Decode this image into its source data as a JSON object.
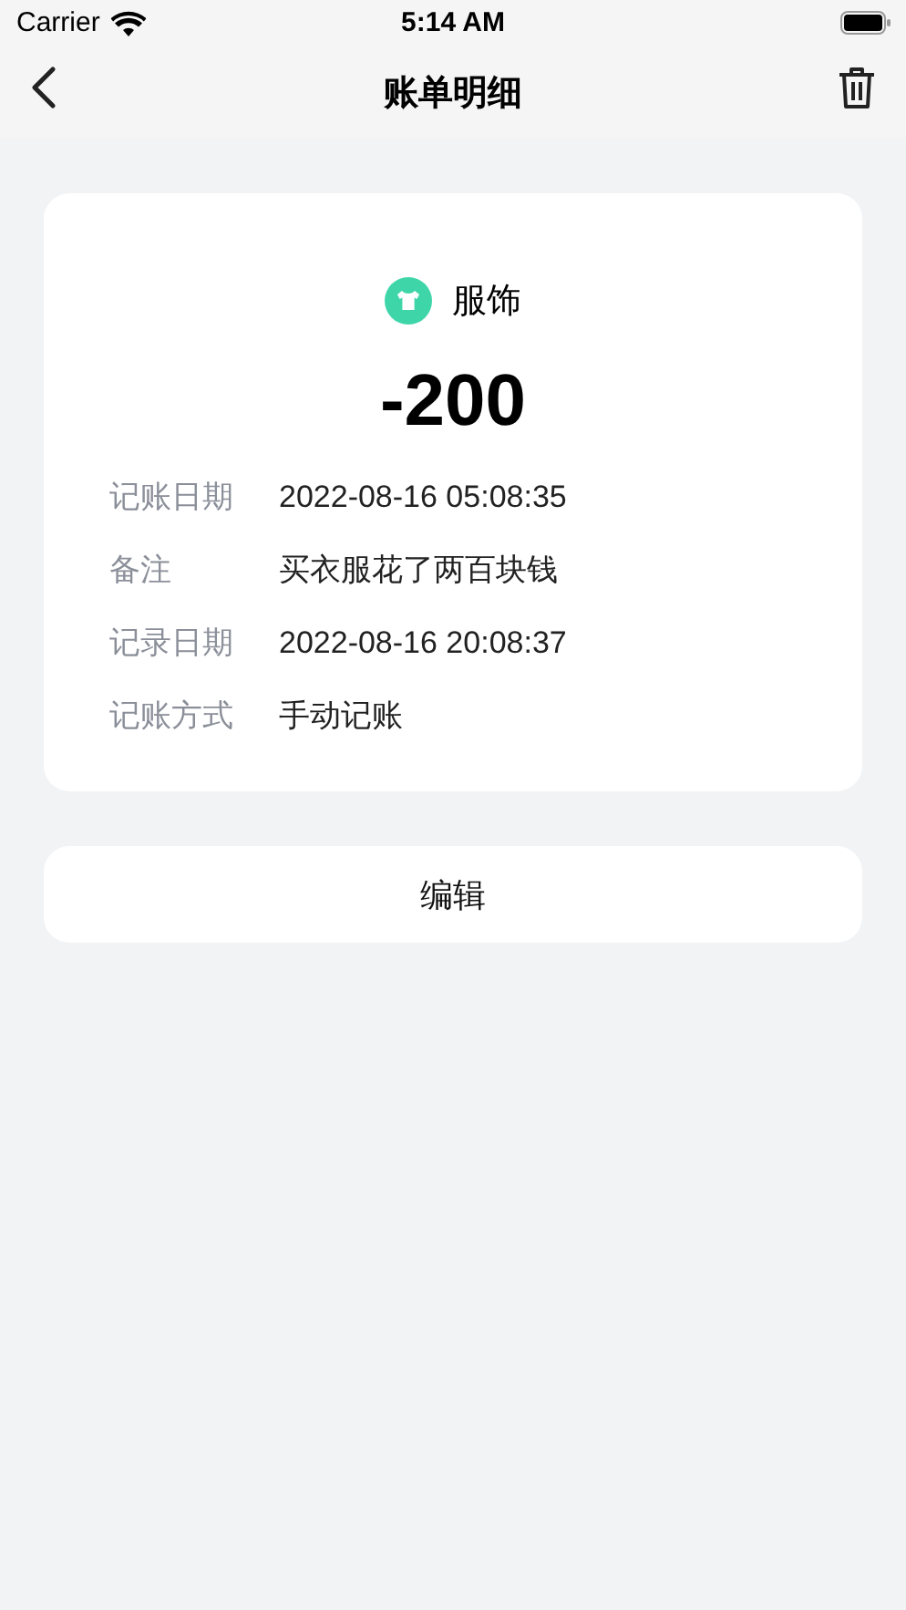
{
  "status_bar": {
    "carrier": "Carrier",
    "time": "5:14 AM"
  },
  "nav": {
    "title": "账单明细"
  },
  "record": {
    "category": "服饰",
    "amount": "-200",
    "fields": [
      {
        "label": "记账日期",
        "value": "2022-08-16 05:08:35"
      },
      {
        "label": "备注",
        "value": "买衣服花了两百块钱"
      },
      {
        "label": "记录日期",
        "value": "2022-08-16 20:08:37"
      },
      {
        "label": "记账方式",
        "value": "手动记账"
      }
    ]
  },
  "edit_button": "编辑"
}
